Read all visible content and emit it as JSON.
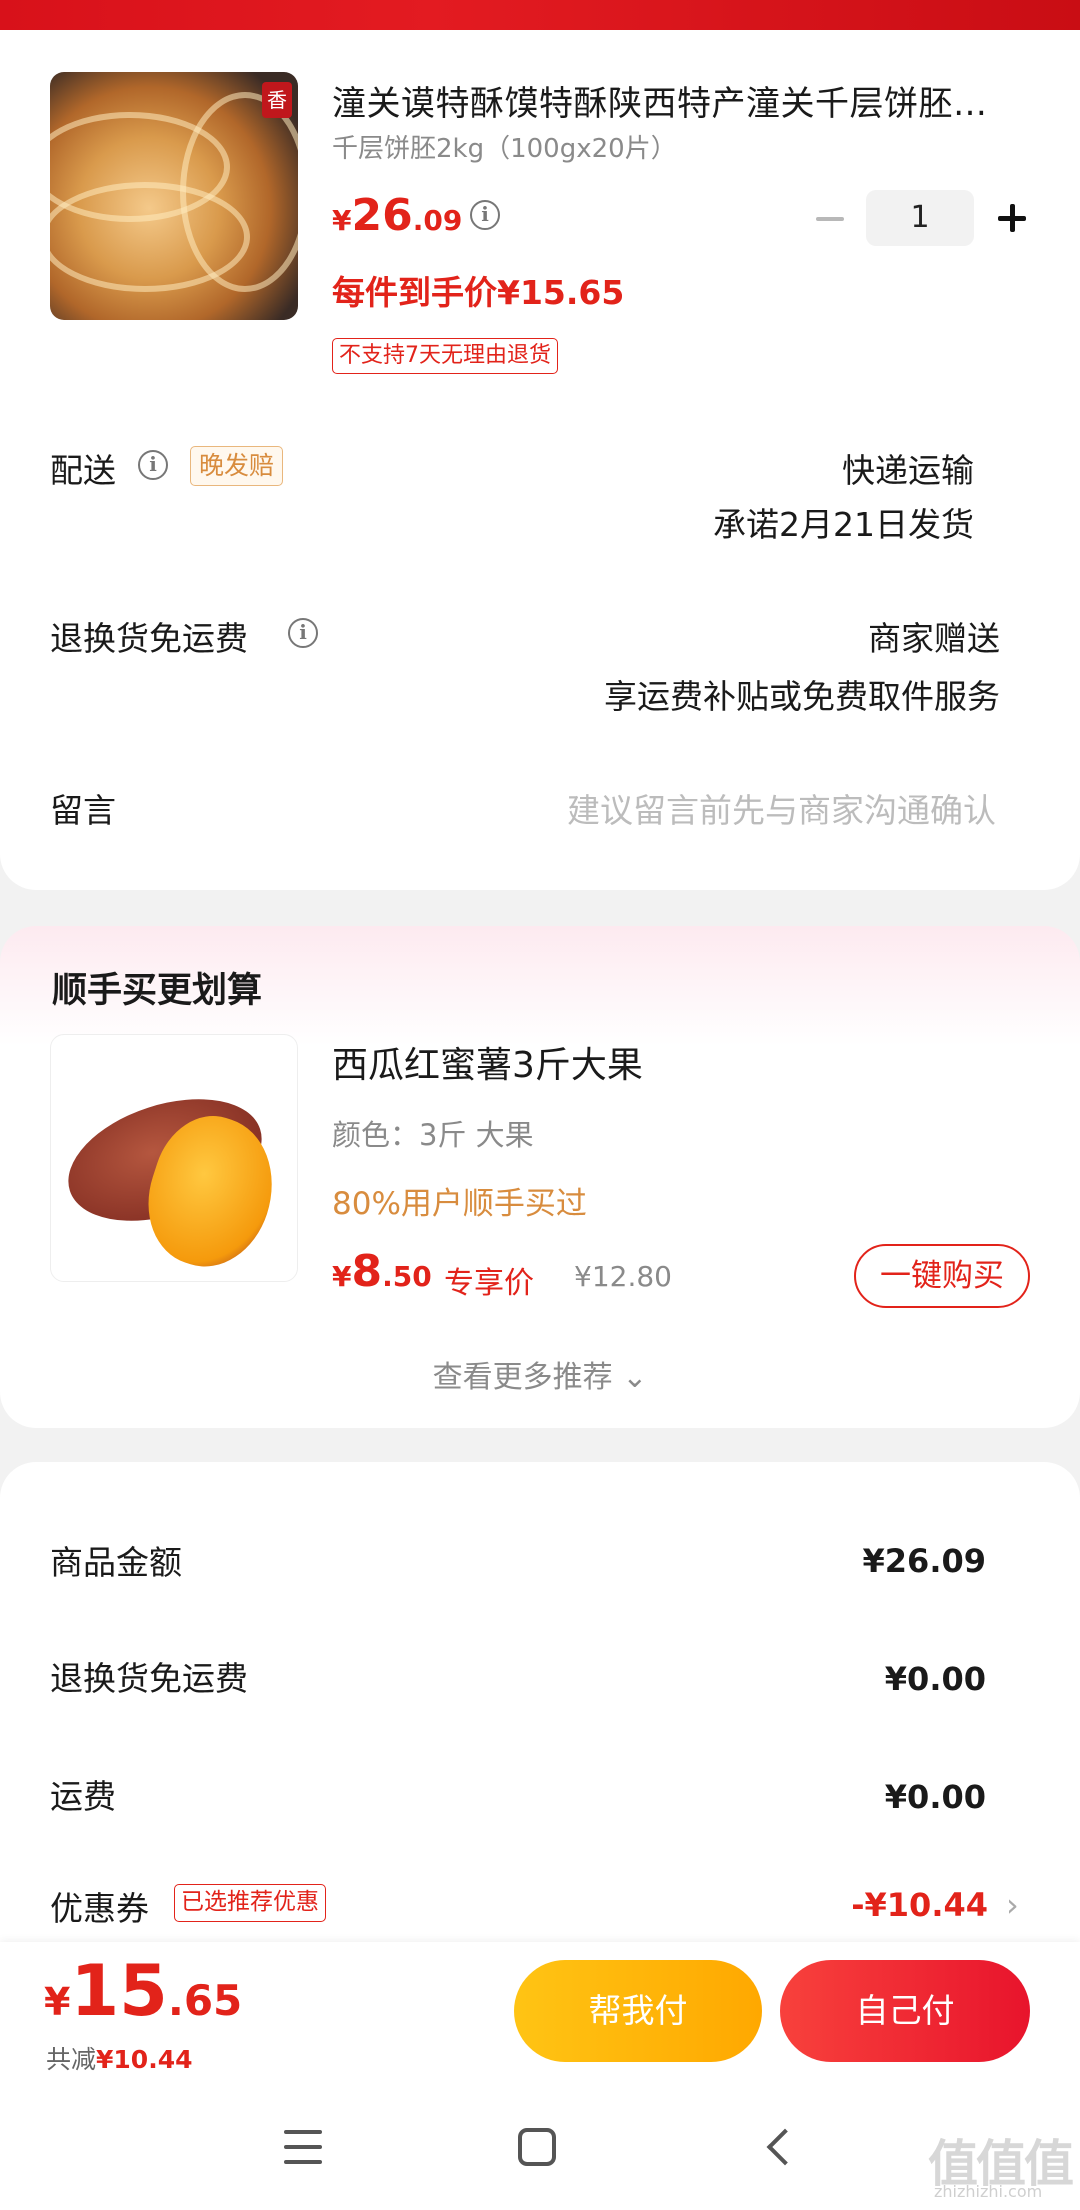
{
  "product": {
    "title": "潼关谟特酥馍特酥陕西特产潼关千层饼胚…",
    "sku": "千层饼胚2kg（100gx20片）",
    "price_currency": "¥",
    "price_int": "26",
    "price_dec": ".09",
    "quantity": "1",
    "unit_price": "每件到手价¥15.65",
    "no_return_tag": "不支持7天无理由退货",
    "image_tag": "香"
  },
  "delivery": {
    "label": "配送",
    "tag": "晚发赔",
    "method": "快递运输",
    "promise": "承诺2月21日发货"
  },
  "return_shipping": {
    "label": "退换货免运费",
    "value": "商家赠送",
    "desc": "享运费补贴或免费取件服务"
  },
  "message": {
    "label": "留言",
    "placeholder": "建议留言前先与商家沟通确认"
  },
  "recommend": {
    "section_title": "顺手买更划算",
    "name": "西瓜红蜜薯3斤大果",
    "spec": "颜色：3斤 大果",
    "hint": "80%用户顺手买过",
    "price_currency": "¥",
    "price_int": "8",
    "price_dec": ".50",
    "exclusive_label": "专享价",
    "original_price": "¥12.80",
    "buy_label": "一键购买",
    "more_label": "查看更多推荐 ⌄"
  },
  "summary": {
    "goods_label": "商品金额",
    "goods_value": "¥26.09",
    "return_label": "退换货免运费",
    "return_value": "¥0.00",
    "shipping_label": "运费",
    "shipping_value": "¥0.00",
    "coupon_label": "优惠券",
    "coupon_tag": "已选推荐优惠",
    "coupon_value": "-¥10.44"
  },
  "bottom": {
    "total_currency": "¥",
    "total_int": "15",
    "total_dec": ".65",
    "saved_label": "共减",
    "saved_value": "¥10.44",
    "help_pay": "帮我付",
    "self_pay": "自己付"
  },
  "watermark": {
    "text": "值值值",
    "url": "zhizhizhi.com"
  },
  "colors": {
    "accent": "#e2231a",
    "help_button": "#ffb800",
    "self_button": "#f0252f",
    "hint_orange": "#d88c3e"
  },
  "icons": {
    "info": "info-icon",
    "minus": "minus-icon",
    "plus": "plus-icon",
    "chevron": "chevron-right-icon",
    "nav_menu": "menu-icon",
    "nav_home": "home-icon",
    "nav_back": "back-icon"
  }
}
